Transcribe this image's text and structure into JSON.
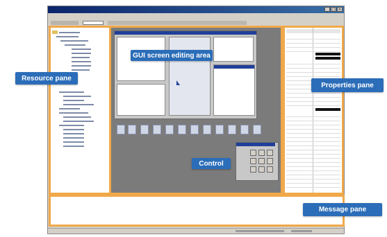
{
  "callouts": {
    "resource": "Resource pane",
    "editing": "GUI screen editing area",
    "properties": "Properties pane",
    "control": "Control",
    "message": "Message pane"
  },
  "colors": {
    "callout": "#2b6db8",
    "highlight": "#f0a84a",
    "title_bar": "#0a246a",
    "editing_bg": "#7b7b7b"
  },
  "icons": [
    "minimize-icon",
    "maximize-icon",
    "close-icon",
    "folder-icon",
    "arrow-cursor-icon"
  ]
}
